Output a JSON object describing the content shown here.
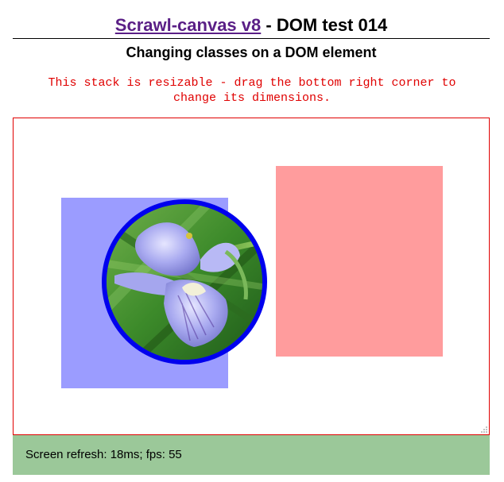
{
  "header": {
    "link_label": "Scrawl-canvas v8",
    "title_suffix": " - DOM test 014",
    "subtitle": "Changing classes on a DOM element"
  },
  "note": {
    "text": "This stack is resizable - drag the bottom right corner to change its dimensions."
  },
  "stack": {
    "border_color": "#e00000",
    "blue_box_color": "#9b9cff",
    "pink_box_color": "#ff9c9d",
    "circle_border_color": "#0000ee",
    "image_subject": "iris-flower"
  },
  "status": {
    "text": "Screen refresh: 18ms; fps: 55",
    "background": "#9bc899"
  },
  "colors": {
    "link": "#5a1f86",
    "note": "#e00000"
  }
}
